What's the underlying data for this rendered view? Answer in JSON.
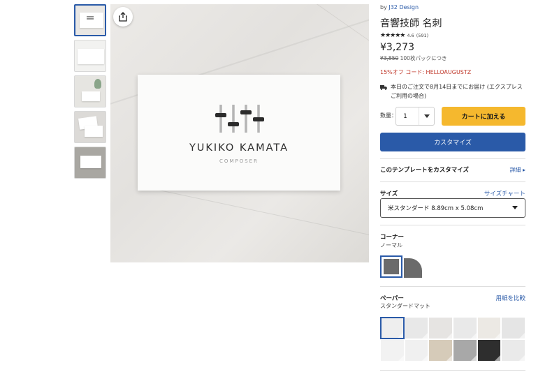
{
  "thumbnails": [
    {
      "name": "thumb-1",
      "active": true
    },
    {
      "name": "thumb-2",
      "active": false
    },
    {
      "name": "thumb-3",
      "active": false
    },
    {
      "name": "thumb-4",
      "active": false
    },
    {
      "name": "thumb-5",
      "active": false
    }
  ],
  "preview": {
    "share_icon": "share-icon",
    "card_name": "YUKIKO KAMATA",
    "card_title": "COMPOSER"
  },
  "product": {
    "by_prefix": "by",
    "designer": "J32 Design",
    "title": "音響技師 名刺",
    "stars": "★★★★★",
    "rating": "4.6",
    "review_count": "(591)",
    "price": "¥3,273",
    "original_price": "¥3,850",
    "pack_note": "100枚パックにつき",
    "promo": "15%オフ コード: HELLOAUGUSTZ",
    "shipping": "本日のご注文で8月14日までにお届け (エクスプレスご利用の場合)"
  },
  "purchase": {
    "qty_label": "数量：",
    "qty_value": "1",
    "add_to_cart": "カートに加える",
    "customize": "カスタマイズ"
  },
  "template_section": {
    "heading": "このテンプレートをカスタマイズ",
    "details_link": "詳細 ▸"
  },
  "size_section": {
    "heading": "サイズ",
    "chart_link": "サイズチャート",
    "selected": "米スタンダード 8.89cm x 5.08cm"
  },
  "corner_section": {
    "heading": "コーナー",
    "selected": "ノーマル"
  },
  "paper_section": {
    "heading": "ペーパー",
    "compare_link": "用紙を比較",
    "selected": "スタンダードマット",
    "swatch_colors": [
      "#eeeeee",
      "#e8e8e8",
      "#e6e4e2",
      "#e9e9e9",
      "#ece9e4",
      "#e5e5e5",
      "#f2f2f2",
      "#f0f0f0",
      "#d6cbb9",
      "#a8a8a8",
      "#2e2e2e",
      "#eaeaea"
    ]
  },
  "colors": {
    "accent": "#2a5aa8",
    "cart": "#f5b82e",
    "promo": "#c0392b"
  }
}
